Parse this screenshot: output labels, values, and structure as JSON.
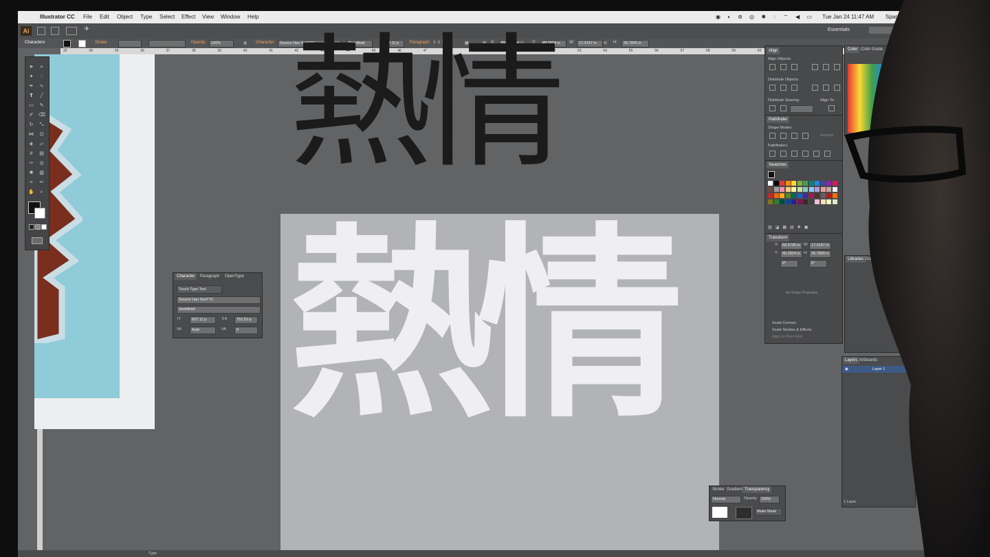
{
  "menubar": {
    "app": "Illustrator CC",
    "items": [
      "File",
      "Edit",
      "Object",
      "Type",
      "Select",
      "Effect",
      "View",
      "Window",
      "Help"
    ],
    "clock": "Tue Jan 24  11:47 AM",
    "user": "Sparrow"
  },
  "apptool": {
    "logo": "Ai",
    "workspace": "Essentials"
  },
  "control_bar": {
    "panel_label": "Characters",
    "stroke_label": "Stroke:",
    "opacity_label": "Opacity:",
    "opacity_value": "100%",
    "character_label": "Character:",
    "font": "Source Han Serif TC",
    "style": "SemiBold",
    "size": "627.11 p",
    "paragraph_label": "Paragraph:",
    "x_label": "X:",
    "x_value": "69.5735 in",
    "y_label": "Y:",
    "y_value": "49.2824 in",
    "w_label": "W:",
    "w_value": "17.4197 in",
    "h_label": "H:",
    "h_value": "26.7809 in"
  },
  "ruler_ticks": [
    "33",
    "34",
    "35",
    "36",
    "37",
    "38",
    "39",
    "40",
    "41",
    "42",
    "43",
    "44",
    "45",
    "46",
    "47",
    "48",
    "49",
    "50",
    "51",
    "52",
    "53",
    "54",
    "55",
    "56",
    "57",
    "58",
    "59",
    "60"
  ],
  "canvas_text": {
    "dark": "熱情",
    "white": "熱情"
  },
  "character_panel": {
    "tabs": [
      "Character",
      "Paragraph",
      "OpenType"
    ],
    "touch_tool": "Touch Type Tool",
    "font": "Source Han Serif TC",
    "style": "SemiBold",
    "size": "627.11 p",
    "leading": "752.53 p",
    "kerning": "Auto",
    "tracking": "0"
  },
  "align_panel": {
    "title": "Align",
    "align_objects": "Align Objects:",
    "distribute_objects": "Distribute Objects:",
    "distribute_spacing": "Distribute Spacing:",
    "align_to": "Align To:"
  },
  "pathfinder_panel": {
    "title": "Pathfinder",
    "shape_modes": "Shape Modes:",
    "expand": "Expand",
    "pathfinders": "Pathfinders:"
  },
  "swatches_panel": {
    "title": "Swatches",
    "colors": [
      "#ffffff",
      "#000000",
      "#e53935",
      "#fb8c00",
      "#fdd835",
      "#7cb342",
      "#43a047",
      "#00897b",
      "#1e88e5",
      "#3949ab",
      "#8e24aa",
      "#d81b60",
      "#6d4c41",
      "#9e9e9e",
      "#f48fb1",
      "#ffcc80",
      "#fff59d",
      "#c5e1a5",
      "#80cbc4",
      "#90caf9",
      "#b39ddb",
      "#ef9a9a",
      "#bcaaa4",
      "#eeeeee",
      "#c62828",
      "#ef6c00",
      "#f9a825",
      "#558b2f",
      "#00695c",
      "#1565c0",
      "#4527a0",
      "#ad1457",
      "#4e342e",
      "#616161",
      "#b71c1c",
      "#ff6f00",
      "#827717",
      "#2e7d32",
      "#004d40",
      "#0d47a1",
      "#311b92",
      "#880e4f",
      "#3e2723",
      "#424242",
      "#f8bbd0",
      "#ffe0b2",
      "#f0f4c3",
      "#dcedc8"
    ]
  },
  "transform_panel": {
    "title": "Transform",
    "x": "69.5735 in",
    "y": "49.2824 in",
    "w": "17.4197 in",
    "h": "26.7809 in",
    "angle": "0°",
    "shear": "0°",
    "no_shape": "No Shape Properties",
    "scale_corners": "Scale Corners",
    "scale_strokes": "Scale Strokes & Effects",
    "align_pixel": "Align to Pixel Grid"
  },
  "color_panel": {
    "tabs": [
      "Color",
      "Color Guide"
    ]
  },
  "libraries_panel": {
    "tabs": [
      "Libraries",
      "Graphic Styles"
    ]
  },
  "layers_panel": {
    "tabs": [
      "Layers",
      "Artboards"
    ],
    "layer": "Layer 1",
    "count": "1 Layer"
  },
  "transparency_panel": {
    "tabs": [
      "Stroke",
      "Gradient",
      "Transparency"
    ],
    "mode": "Normal",
    "opacity_label": "Opacity:",
    "opacity": "100%",
    "make_mask": "Make Mask"
  },
  "status_bar": {
    "tool": "Type"
  }
}
